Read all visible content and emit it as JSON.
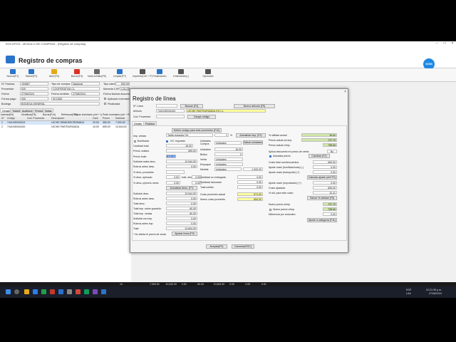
{
  "window": {
    "title": "ROCOPOS - MODULO DE COMPRAS - [Registro de compras]",
    "controls": [
      "–",
      "□",
      "×"
    ]
  },
  "header": {
    "title": "Registro de compras",
    "brand": "DGM"
  },
  "toolbar": [
    {
      "label": "Nuevo(F1)",
      "color": "#2a74c9"
    },
    {
      "label": "Salvar(F2)",
      "color": "#2a74c9"
    },
    {
      "label": "Abrir(F3)",
      "color": "#e6a817"
    },
    {
      "label": "Borrar(F4)",
      "color": "#d93025"
    },
    {
      "label": "Nota crédito(F5)",
      "color": "#6b6b6b"
    },
    {
      "label": "Limpiar(F7)",
      "color": "#2a74c9"
    },
    {
      "label": "Imprimir(Ctrl + P)",
      "color": "#555"
    },
    {
      "label": "Finalización",
      "color": "#2a74c9"
    },
    {
      "label": "Ordenación(-)",
      "color": "#555"
    },
    {
      "label": "Opciones",
      "color": "#555"
    }
  ],
  "form": {
    "num_factura_label": "N° Factura",
    "num_factura": "104567",
    "tipo_label": "Tipo de compra",
    "tipo": "Nacional",
    "proveedor_label": "Proveedor",
    "proveedor": "025",
    "proveedor_name": "COOPERATIVA CL",
    "fecha_label": "Fecha",
    "fecha": "27/08/2024",
    "fecha_recibido_label": "Fecha recibido",
    "fecha_recibido": "27/08/2024",
    "forma_pago_label": "Forma pago",
    "forma_pago": "030",
    "forma_pago_name": "30 DÍAS",
    "bodega_label": "Bodega",
    "bodega": "BODEGA GENERAL",
    "tipo_cambio_label": "Tipo cambio",
    "tipo_cambio": "500.00",
    "moneda_label": "Moneda CXP",
    "moneda": "COLONES",
    "fecha_doc_label": "Fecha factura documento",
    "finalizada_label": "Finalizada",
    "aplicada_label": "Aplicado inventario"
  },
  "tabs": [
    "Detalle",
    "Totales",
    "Auditoría",
    "Precios",
    "Notas"
  ],
  "grid_actions": [
    "Insertar(F6)",
    "Modificar(F8)",
    "Borrar(F10)",
    "Refrescar(F12)"
  ],
  "grid_extra": [
    "Borrar inventario (ctrl + I)",
    "Pedir inventario (ctrl + R)"
  ],
  "grid_columns": [
    "N°",
    "Código",
    "Cód. Proveedor",
    "Descripción",
    "Cant.",
    "Precio",
    "Subtotal"
  ],
  "grid_rows": [
    {
      "n": "1",
      "codigo": "7441030016313",
      "prov": "",
      "desc": "LECHE SEMIDESCREMADA",
      "cant": "20.00",
      "precio": "350.00",
      "sub": "7,000.00"
    },
    {
      "n": "2",
      "codigo": "7441030016100",
      "prov": "",
      "desc": "LECHE PASTEURIZADA",
      "cant": "16.00",
      "precio": "659.00",
      "sub": "10,544.00"
    }
  ],
  "dialog": {
    "title": "Registro de línea",
    "num_linea_label": "N° Línea",
    "num_linea": "",
    "buscar_btn": "Buscar (F4)",
    "nuevo_articulo_btn": "Nuevo artículo (F5)",
    "articulo_label": "Artículo",
    "articulo": "7441030016100",
    "articulo_desc": "LECHE PASTEURIZADA 2% 1 L",
    "cod_prov_label": "Cód. Proveedor",
    "cod_prov": "",
    "cargar_btn": "Cargar código",
    "tabs": [
      "Detalle",
      "Pedidos"
    ],
    "definir_btn": "Definir código para este proveedor (F12)",
    "imp_ventas_label": "Imp. ventas",
    "tarifa_label": "Tarifa reducida (%)",
    "tarifa": "1",
    "pct": "%",
    "actualizar_imp_btn": "Actualizar imp. (F3)",
    "bonificado_label": "Bonificado",
    "iva_label": "IVC Impuesto",
    "cantidad_label": "Cantidad total",
    "cantidad": "16.00",
    "precio_unit_label": "Precio unitario",
    "precio_unit": "659.00",
    "precio_bulto_label": "Precio bulto",
    "precio_bulto": "659.00",
    "subtotal_label": "Subtotal antes desc.",
    "subtotal": "10,544.00",
    "rubros_label": "Rubros antes desc.",
    "rubros": "0.00",
    "desc_proc_label": "% desc. procedido",
    "desc_proc": "",
    "desc_aplicado_label": "% desc. aplicado",
    "desc_aplicado": "0.00",
    "bulk_label": "bulk. desc.",
    "bulk": "0.00",
    "desc_precio_label": "% desc. p/precio venta",
    "desc_precio": "0.00",
    "bulk2": "0.00",
    "actualizar_desc_btn": "Actualizar desc. (F7)",
    "subtotal_desc_label": "Subtotal desc.",
    "subtotal_desc": "10,544.00",
    "rubros_desc_label": "Rubros antes desc.",
    "rubros_desc": "0.00",
    "total_desc_label": "Total desc.",
    "total_desc": "0.00",
    "total_imp_label": "Total imp. sobre grava/do",
    "total_imp": "60.00",
    "total_venta_label": "Total imp. ventas",
    "total_venta": "60.00",
    "subtotal_imp_label": "Subtotal con imp.",
    "subtotal_imp": "0.00",
    "rubros_imp_label": "Rubros antes imp.",
    "rubros_imp": "0.00",
    "total_label": "Total",
    "total": "10,604.00",
    "afecta_label": "* No afecta el precio de venta",
    "ajustar_btn": "Ajustar línea (F9)",
    "unidades_label": "Unidades",
    "unidades": "Unidades",
    "compra_label": "Compra",
    "salvar_unidades_btn": "Salvar unidades",
    "unidades2_label": "Unidades",
    "unidades2": "16.00",
    "bultos_label": "Bultos",
    "bultos": "0",
    "venta_label": "Venta",
    "venta": "Unidades",
    "empaque_label": "Empaque",
    "empaque": "Unidades",
    "medida_label": "Medida",
    "medida": "Unidades",
    "medida_val": "1.000.00",
    "cant_entregada_label": "Cantidad no entregada",
    "cant_entregada": "0.00",
    "cant_facturada_label": "Cantidad facturada",
    "cant_facturada": "0.00",
    "total_credito_label": "Total crédito",
    "total_credito": "0.00",
    "costo_actual_label": "Costo promedio actual",
    "costo_actual": "571.00",
    "nuevo_costo_label": "Nuevo costo promedio",
    "nuevo_costo": "654.00",
    "util_actual_label": "% utilidad actual",
    "util_actual": "10.41",
    "precio_sin_label": "Precio actual sin imp.",
    "precio_sin": "727.72",
    "precio_con_label": "Precio actual c/imp.",
    "precio_con": "735.00",
    "aplica_desc_label": "Aplica descuento en precio de venta",
    "aplica_desc": "No",
    "actualiza_precio_label": "Actualiza precio",
    "cambiar_btn": "Cambiar (F2)",
    "costo_sin_label": "Costo total con/descuentos",
    "costo_sin": "659.00",
    "ajuste_costo_label": "Ajuste costo (bonificaciones) (-)",
    "ajuste_costo": "0.00",
    "ajuste_transp_label": "Ajuste costo (transporte) (+)",
    "ajuste_transp": "0.00",
    "calcular_btn": "Calcular ajuste (ctrl+F2)",
    "ajuste_imp_label": "Ajuste costo (importación) (+)",
    "ajuste_imp": "0.00",
    "costo_ajust_label": "Costo ajustado",
    "costo_ajust": "659.00",
    "util_nueva_label": "% util. para este costo",
    "util_nueva": "10.41",
    "salvar_util_btn": "Salvar % utilidad (F5)",
    "nuevo_precio_label": "Nuevo precio s/imp",
    "nuevo_precio": "727.72",
    "nuevo_precio_c_label": "Nuevo precio c/imp.",
    "nuevo_precio_c": "735.00",
    "dif_label": "Diferencia por redondeo",
    "dif": "0.00",
    "ajuste_cat_btn": "Ajuste a categoría (F11)",
    "aceptar_btn": "Aceptar(F3)",
    "cancelar_btn": "Cancelar(ESC)"
  },
  "status": [
    "10",
    "7,963.00",
    "10,000.00",
    "0.00",
    "60.00",
    "10,604.00",
    "0.00",
    "0.00",
    "0.00"
  ],
  "taskbar": {
    "lang": "ESP",
    "region": "LAA",
    "time": "02:21:35 p.m.",
    "date": "27/08/2024"
  }
}
